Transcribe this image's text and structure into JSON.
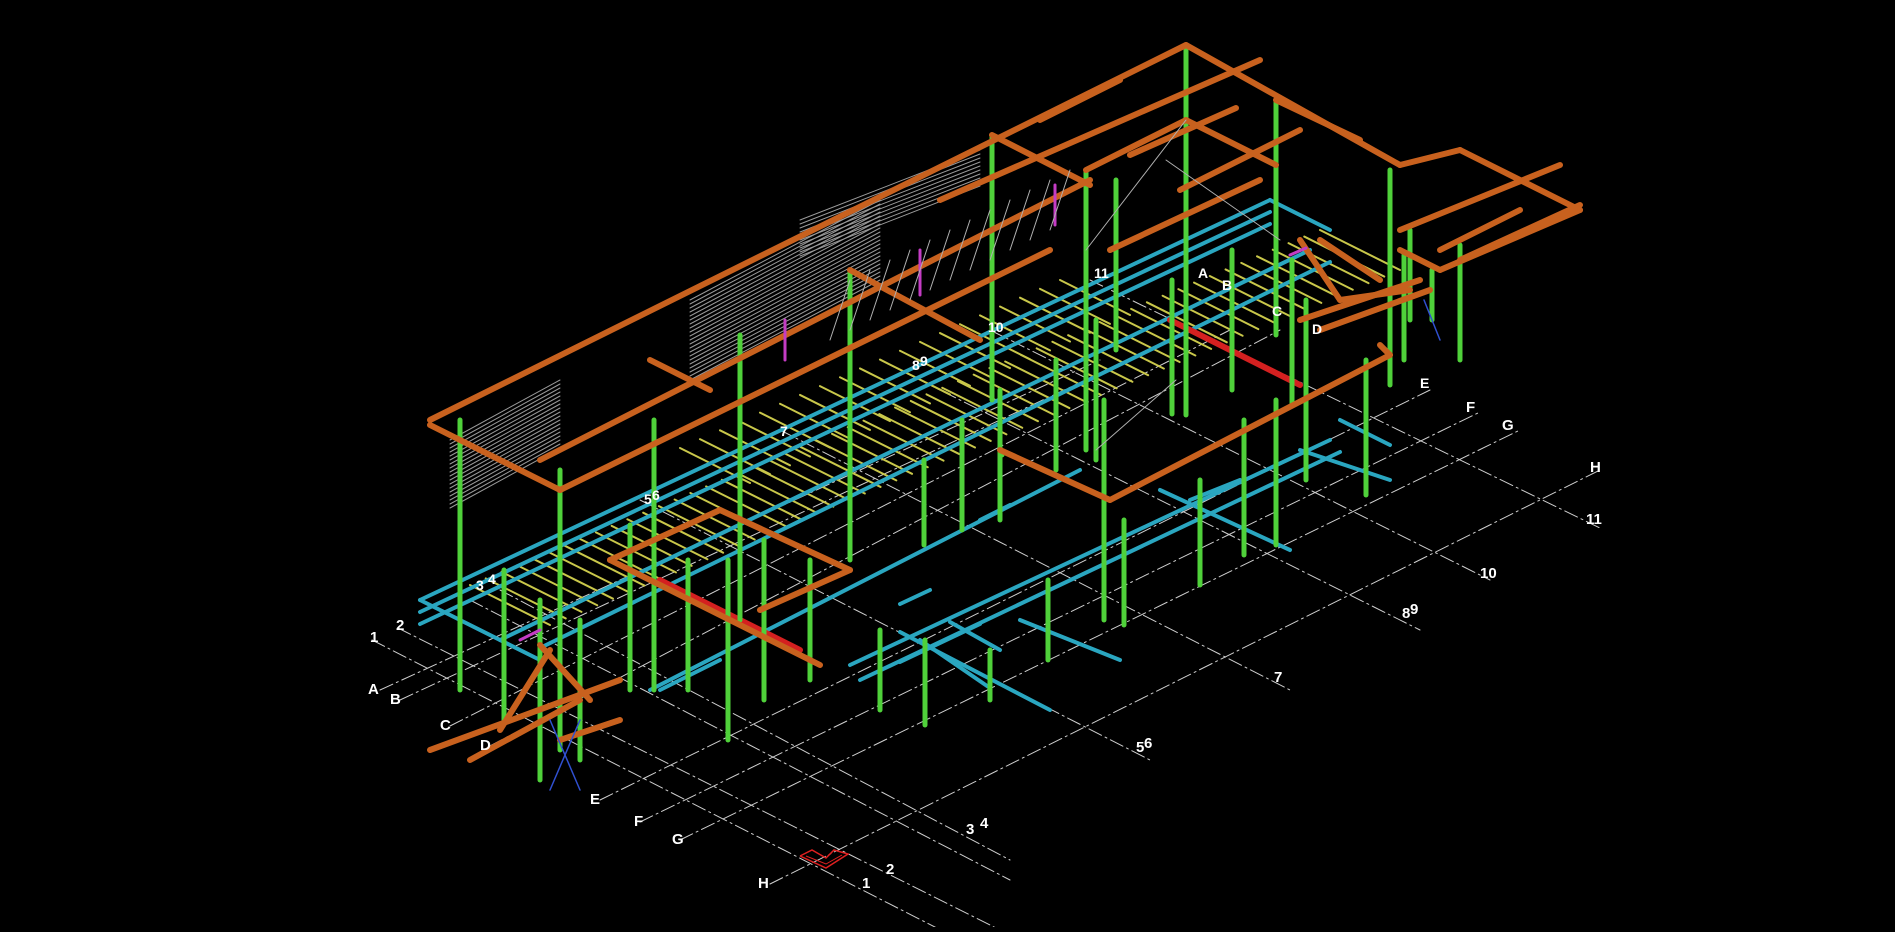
{
  "colors": {
    "background": "#000000",
    "column": "#4fd13a",
    "roof_beam": "#c8611e",
    "floor_beam": "#2aa6c0",
    "joist": "#c9c74a",
    "transfer_beam": "#d42020",
    "brace": "#c43cc4",
    "purlin": "#9a9a9a",
    "cross_brace": "#3050d0",
    "ucs_icon": "#e02020",
    "gridline": "#cfcfcf",
    "label": "#ffffff"
  },
  "grid_labels": {
    "numbers_front": [
      "1",
      "2",
      "3",
      "4",
      "5",
      "6",
      "7",
      "8",
      "9",
      "10",
      "11"
    ],
    "letters_left": [
      "A",
      "B",
      "C",
      "D",
      "E",
      "F",
      "G",
      "H"
    ],
    "numbers_near": [
      "1",
      "2",
      "3",
      "4",
      "5",
      "6",
      "7",
      "8",
      "9",
      "10",
      "11"
    ],
    "letters_right": [
      "F",
      "G",
      "H"
    ]
  },
  "structure_labels": [
    "3",
    "4",
    "5",
    "6",
    "7",
    "8",
    "9",
    "10",
    "11",
    "A",
    "B",
    "C",
    "D",
    "E"
  ]
}
